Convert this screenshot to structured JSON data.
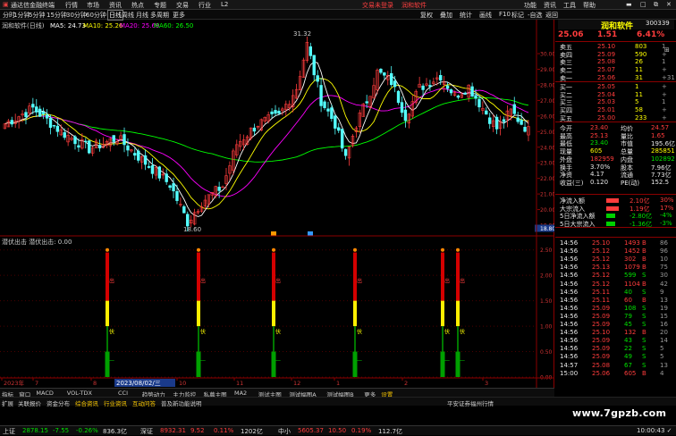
{
  "menubar": {
    "title": "通达信金融终端",
    "items": [
      "行情",
      "市场",
      "资讯",
      "热点",
      "专题",
      "交易",
      "行业",
      "L2"
    ],
    "banner": "交易未登录",
    "banner2": "润和软件",
    "right_items": [
      "功能",
      "资讯",
      "工具",
      "帮助"
    ]
  },
  "toolbar": {
    "periods": [
      "分时",
      "1分钟",
      "5分钟",
      "15分钟",
      "30分钟",
      "60分钟",
      "日线",
      "周线",
      "月线",
      "多周期",
      "更多"
    ],
    "active_period": "日线",
    "right_items": [
      "复权",
      "叠加",
      "统计",
      "画线",
      "F10",
      "标记",
      "-自选",
      "返回"
    ]
  },
  "chart": {
    "ma_label": "润和软件(日线)",
    "ma5": "MA5: 24.73",
    "ma10": "MA10: 25.26",
    "ma20": "MA20: 25.69",
    "ma60": "MA60: 26.50",
    "high_label": "31.32",
    "low_label": "18.60",
    "price_ticks": [
      "30.00",
      "29.00",
      "28.00",
      "27.00",
      "26.00",
      "25.00",
      "24.00",
      "23.00",
      "22.00",
      "21.00",
      "20.00",
      "19.00",
      "18.80"
    ],
    "indicator_title": "潜伏出击  潜伏出击: 0.00",
    "ind_ticks": [
      "2.50",
      "2.00",
      "1.50",
      "1.00",
      "0.50",
      "0.00"
    ],
    "signals": [
      "出",
      "伏",
      "出",
      "伏",
      "出",
      "伏",
      "出",
      "伏",
      "出",
      "伏",
      "出",
      "伏",
      "出",
      "伏"
    ],
    "x_labels": [
      "2023年",
      "7",
      "8",
      "9",
      "10",
      "11",
      "12",
      "1",
      "2",
      "3"
    ],
    "cursor_date": "2023/08/02/三"
  },
  "chart_data": {
    "type": "candlestick",
    "title": "润和软件(日线)",
    "ylim": [
      18.6,
      31.32
    ],
    "ma": {
      "MA5": 24.73,
      "MA10": 25.26,
      "MA20": 25.69,
      "MA60": 26.5
    },
    "highest": 31.32,
    "lowest": 18.6
  },
  "quote": {
    "name": "润和软件",
    "code": "300339",
    "price": "25.06",
    "change": "1.51",
    "pct": "6.41%",
    "asks": [
      {
        "label": "卖五",
        "price": "25.10",
        "vol": "803",
        "d": "1"
      },
      {
        "label": "卖四",
        "price": "25.09",
        "vol": "590",
        "d": "+"
      },
      {
        "label": "卖三",
        "price": "25.08",
        "vol": "26",
        "d": "1"
      },
      {
        "label": "卖二",
        "price": "25.07",
        "vol": "11",
        "d": "+"
      },
      {
        "label": "卖一",
        "price": "25.06",
        "vol": "31",
        "d": "+31"
      }
    ],
    "bids": [
      {
        "label": "买一",
        "price": "25.05",
        "vol": "1",
        "d": "+"
      },
      {
        "label": "买二",
        "price": "25.04",
        "vol": "11",
        "d": "+"
      },
      {
        "label": "买三",
        "price": "25.03",
        "vol": "5",
        "d": "1"
      },
      {
        "label": "买四",
        "price": "25.01",
        "vol": "58",
        "d": "+"
      },
      {
        "label": "买五",
        "price": "25.00",
        "vol": "233",
        "d": "+"
      }
    ],
    "stats": [
      {
        "l1": "今开",
        "v1": "23.40",
        "l2": "均价",
        "v2": "24.57"
      },
      {
        "l1": "最高",
        "v1": "25.13",
        "l2": "量比",
        "v2": "1.65"
      },
      {
        "l1": "最低",
        "v1": "23.40",
        "l2": "市值",
        "v2": "195.6亿"
      },
      {
        "l1": "现量",
        "v1": "605",
        "l2": "总量",
        "v2": "285851"
      },
      {
        "l1": "外盘",
        "v1": "182959",
        "l2": "内盘",
        "v2": "102892"
      },
      {
        "l1": "换手",
        "v1": "3.70%",
        "l2": "股本",
        "v2": "7.96亿"
      },
      {
        "l1": "净资",
        "v1": "4.17",
        "l2": "流通",
        "v2": "7.73亿"
      },
      {
        "l1": "收益(三)",
        "v1": "0.120",
        "l2": "PE(动)",
        "v2": "152.5"
      }
    ],
    "flows": [
      {
        "label": "净流入额",
        "val": "2.10亿",
        "pct": "30%",
        "c": "red"
      },
      {
        "label": "大宗流入",
        "val": "1.19亿",
        "pct": "17%",
        "c": "red"
      },
      {
        "label": "5日净流入额",
        "val": "-2.80亿",
        "pct": "-4%",
        "c": "grn"
      },
      {
        "label": "5日大宗流入",
        "val": "-1.36亿",
        "pct": "-3%",
        "c": "grn"
      }
    ],
    "ticks": [
      {
        "t": "14:56",
        "p": "25.10",
        "v": "1493",
        "d": "B",
        "n": "86"
      },
      {
        "t": "14:56",
        "p": "25.12",
        "v": "1452",
        "d": "B",
        "n": "96"
      },
      {
        "t": "14:56",
        "p": "25.12",
        "v": "302",
        "d": "B",
        "n": "10"
      },
      {
        "t": "14:56",
        "p": "25.13",
        "v": "1079",
        "d": "B",
        "n": "75"
      },
      {
        "t": "14:56",
        "p": "25.12",
        "v": "599",
        "d": "S",
        "n": "30"
      },
      {
        "t": "14:56",
        "p": "25.12",
        "v": "1104",
        "d": "B",
        "n": "42"
      },
      {
        "t": "14:56",
        "p": "25.11",
        "v": "40",
        "d": "S",
        "n": "9"
      },
      {
        "t": "14:56",
        "p": "25.11",
        "v": "60",
        "d": "B",
        "n": "13"
      },
      {
        "t": "14:56",
        "p": "25.09",
        "v": "108",
        "d": "S",
        "n": "19"
      },
      {
        "t": "14:56",
        "p": "25.09",
        "v": "79",
        "d": "S",
        "n": "15"
      },
      {
        "t": "14:56",
        "p": "25.09",
        "v": "45",
        "d": "S",
        "n": "16"
      },
      {
        "t": "14:56",
        "p": "25.10",
        "v": "132",
        "d": "B",
        "n": "20"
      },
      {
        "t": "14:56",
        "p": "25.09",
        "v": "43",
        "d": "S",
        "n": "14"
      },
      {
        "t": "14:56",
        "p": "25.09",
        "v": "22",
        "d": "S",
        "n": "5"
      },
      {
        "t": "14:56",
        "p": "25.09",
        "v": "49",
        "d": "S",
        "n": "5"
      },
      {
        "t": "14:57",
        "p": "25.08",
        "v": "67",
        "d": "S",
        "n": "13"
      },
      {
        "t": "15:00",
        "p": "25.06",
        "v": "605",
        "d": "B",
        "n": "4"
      }
    ]
  },
  "bottom_tabs": [
    "指标",
    "窗口",
    "MACD",
    "VOL-TDX",
    "CCI",
    "趋势动力",
    "主力监控",
    "私募主图",
    "MA2",
    "测试主图",
    "测试幅图A",
    "测试幅图B",
    "更多",
    "设置"
  ],
  "bar2": [
    "扩展",
    "关联报价",
    "资金分布",
    "综合资讯",
    "行业资讯",
    "互动问答",
    "普及新功能说明"
  ],
  "bar2_right": "平安证券福州行情",
  "statusbar": [
    {
      "label": "上证",
      "val": "2878.15",
      "chg": "-7.55",
      "pct": "-0.26%",
      "amt": "836.3亿",
      "c": "grn"
    },
    {
      "label": "深证",
      "val": "8932.31",
      "chg": "9.52",
      "pct": "0.11%",
      "amt": "1202亿",
      "c": "red"
    },
    {
      "label": "中小",
      "val": "5605.37",
      "chg": "10.50",
      "pct": "0.19%",
      "amt": "112.7亿",
      "c": "red"
    }
  ],
  "clock": "10:00:43 ✓",
  "watermark": "www.7gpzb.com"
}
